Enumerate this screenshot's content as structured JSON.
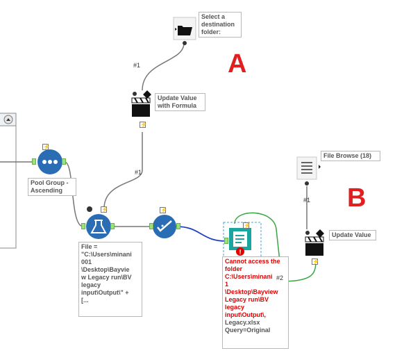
{
  "annotations": {
    "select_folder": [
      "Select a",
      "destination",
      "folder:"
    ],
    "update_formula": [
      "Update Value",
      "with Formula"
    ],
    "pool_group": [
      "Pool Group -",
      "Ascending"
    ],
    "file_formula": [
      "File =",
      "\"C:\\Users\\minani",
      "001",
      "\\Desktop\\Bayvie",
      "w Legacy run\\BV",
      "legacy",
      "input\\Output\\\" +",
      "[..."
    ],
    "error_msg": [
      "Cannot access the",
      "folder",
      "C:\\Users\\minani",
      "1",
      "\\Desktop\\Bayview",
      "Legacy run\\BV",
      "legacy",
      "input\\Output\\,"
    ],
    "output_info": [
      "Legacy.xlsx",
      "Query=Original"
    ],
    "file_browse": "File Browse (18)",
    "update_value": "Update Value"
  },
  "connection_labels": {
    "c1": "#1",
    "c2": "#1",
    "c3": "#1",
    "c4": "#2"
  },
  "markers": {
    "a": "A",
    "b": "B"
  },
  "colors": {
    "tool_blue": "#2a6db5",
    "tool_teal": "#1aa5a0",
    "wire_gray": "#777777",
    "wire_blue": "#1f3fbf",
    "wire_green": "#3aa545",
    "error_red": "#e00000"
  }
}
